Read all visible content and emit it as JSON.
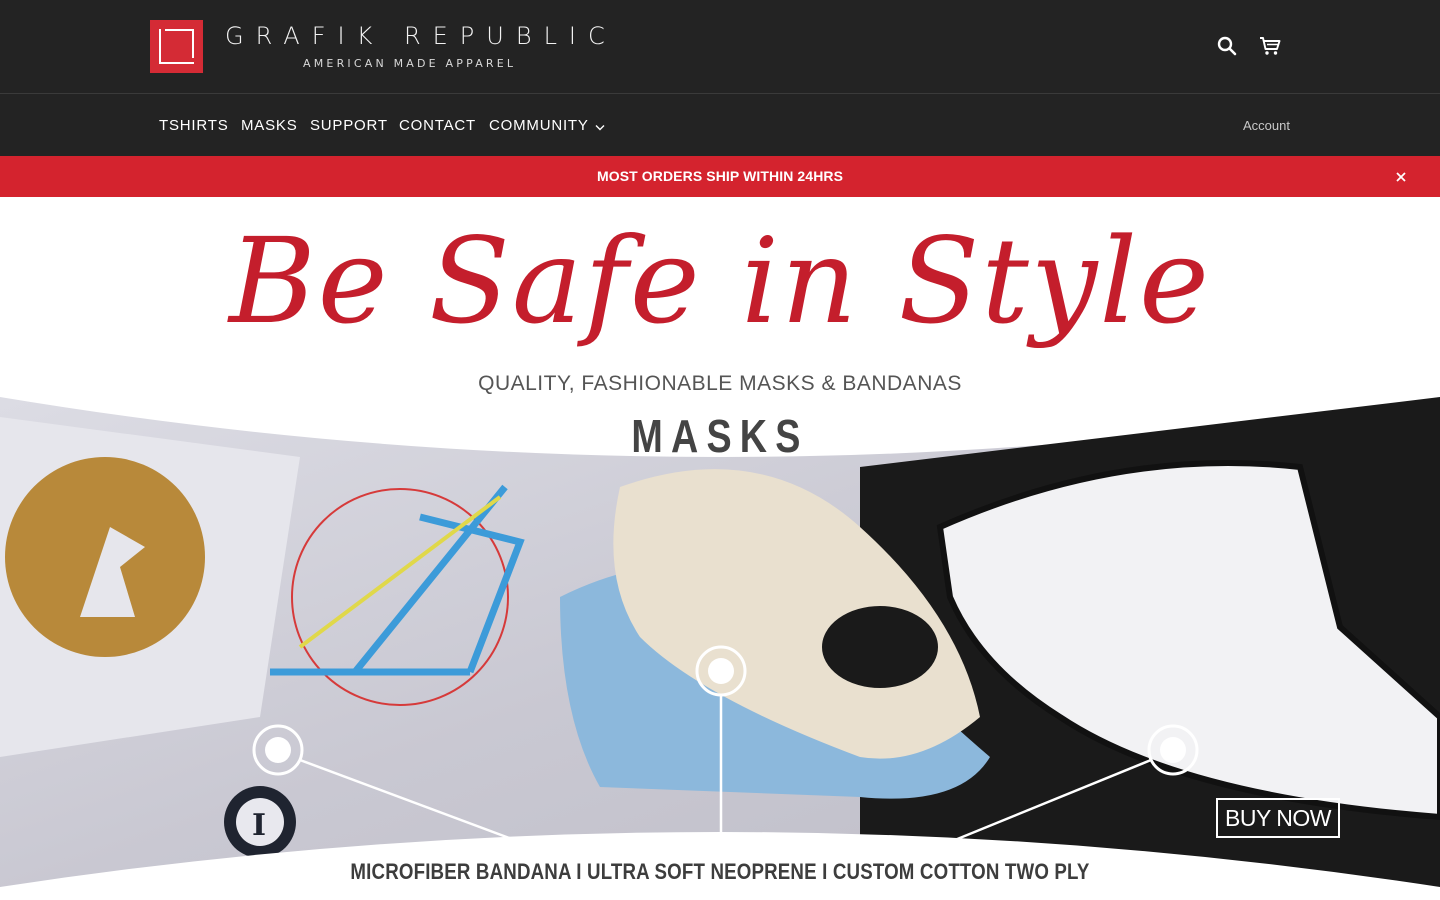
{
  "brand": {
    "title": "GRAFIK REPUBLIC",
    "subtitle": "AMERICAN MADE APPAREL",
    "accent_color": "#d42b35"
  },
  "header": {
    "icons": {
      "search": "search-icon",
      "cart": "cart-icon"
    }
  },
  "nav": {
    "items": [
      {
        "label": "TSHIRTS"
      },
      {
        "label": "MASKS"
      },
      {
        "label": "SUPPORT"
      },
      {
        "label": "CONTACT"
      },
      {
        "label": "COMMUNITY"
      }
    ],
    "account_label": "Account"
  },
  "announcement": {
    "text": "MOST ORDERS SHIP WITHIN 24HRS",
    "background_color": "#d4232e"
  },
  "hero": {
    "script_title": "Be Safe in Style",
    "tagline": "QUALITY, FASHIONABLE MASKS & BANDANAS",
    "heading": "MASKS",
    "button_label": "BUY NOW",
    "caption": "MICROFIBER BANDANA  I  ULTRA SOFT NEOPRENE  I  CUSTOM COTTON TWO PLY"
  }
}
